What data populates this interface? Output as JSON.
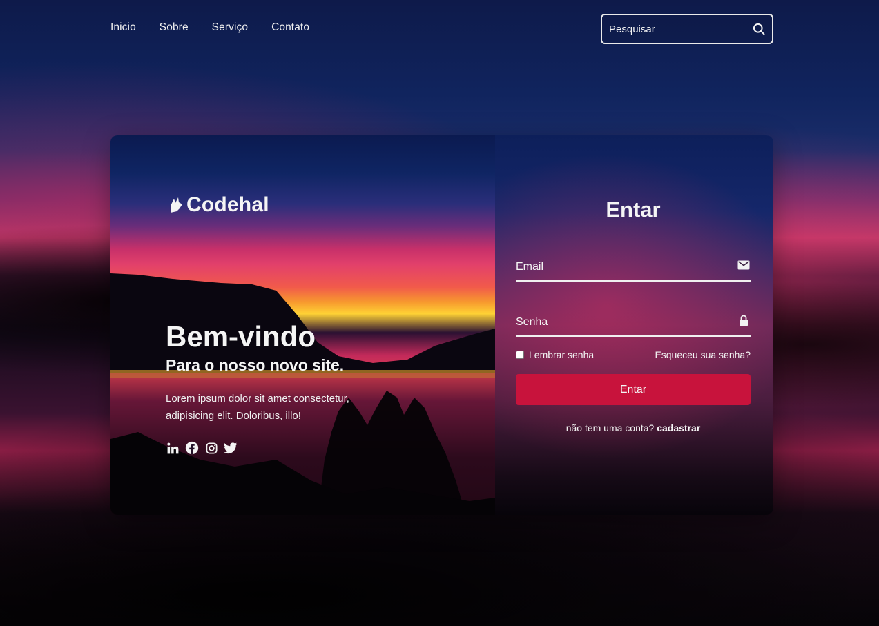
{
  "nav": {
    "items": [
      {
        "label": "Inicio"
      },
      {
        "label": "Sobre"
      },
      {
        "label": "Serviço"
      },
      {
        "label": "Contato"
      }
    ]
  },
  "search": {
    "placeholder": "Pesquisar",
    "icon": "search-icon"
  },
  "brand": {
    "name": "Codehal",
    "icon": "feather-logo-icon"
  },
  "welcome": {
    "title": "Bem-vindo",
    "subtitle": "Para o nosso novo site.",
    "body": "Lorem ipsum dolor sit amet consectetur, adipisicing elit. Doloribus, illo!"
  },
  "social": [
    "linkedin-icon",
    "facebook-icon",
    "instagram-icon",
    "twitter-icon"
  ],
  "login": {
    "title": "Entar",
    "email_placeholder": "Email",
    "password_placeholder": "Senha",
    "remember_label": "Lembrar senha",
    "forgot_label": "Esqueceu sua senha?",
    "submit_label": "Entar",
    "signup_prompt": "não tem uma conta?",
    "signup_link": "cadastrar"
  },
  "colors": {
    "accent": "#c8133c",
    "text": "#f5f5f5"
  }
}
